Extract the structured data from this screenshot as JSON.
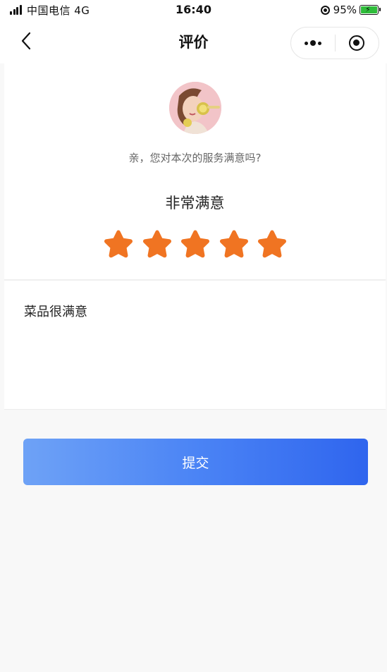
{
  "status_bar": {
    "carrier": "中国电信 4G",
    "time": "16:40",
    "battery_percent": "95%"
  },
  "nav": {
    "title": "评价"
  },
  "rating": {
    "prompt": "亲，您对本次的服务满意吗?",
    "label": "非常满意",
    "stars_filled": 5,
    "stars_total": 5,
    "star_color": "#f07422"
  },
  "comment": {
    "value": "菜品很满意"
  },
  "actions": {
    "submit_label": "提交"
  },
  "colors": {
    "accent_start": "#6ea2f6",
    "accent_end": "#2f65ee"
  }
}
